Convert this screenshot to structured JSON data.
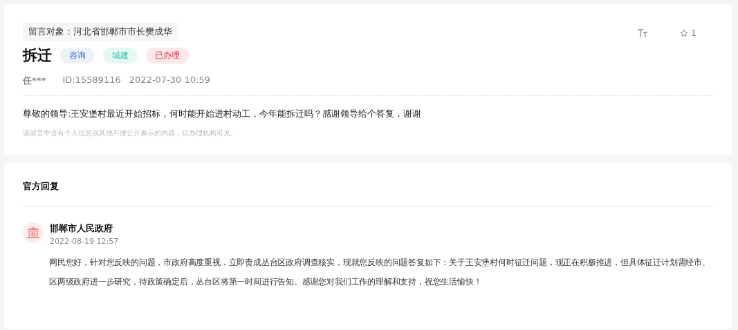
{
  "message": {
    "recipient": "留言对象：河北省邯郸市市长樊成华",
    "title": "拆迁",
    "tags": [
      {
        "label": "咨询",
        "color": "#eef1f6"
      },
      {
        "label": "城建",
        "color": "#e6f8f4"
      },
      {
        "label": "已办理",
        "color": "#fde8ea"
      }
    ],
    "favorites": "1",
    "author": "任***",
    "id": "ID:15589116",
    "time": "2022-07-30 10:59",
    "body": "尊敬的领导:王安堡村最近开始招标，何时能开始进村动工，今年能拆迁吗？感谢领导给个答复，谢谢",
    "notice": "该留言中含有个人信息或其他不便公开展示的内容，仅办理机构可见。"
  },
  "reply": {
    "heading": "官方回复",
    "org": "邯郸市人民政府",
    "time": "2022-08-19 12:57",
    "body": "网民您好，针对您反映的问题，市政府高度重视，立即责成丛台区政府调查核实，现就您反映的问题答复如下：关于王安堡村何时征迁问题，现正在积极推进，但具体征迁计划需经市、区两级政府进一步研究，待政策确定后，丛台区将第一时间进行告知。感谢您对我们工作的理解和支持，祝您生活愉快！"
  }
}
